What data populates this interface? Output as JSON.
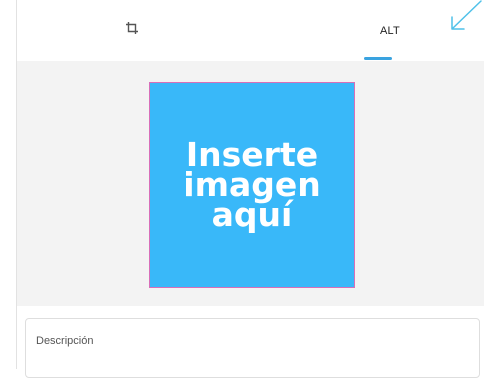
{
  "tabs": {
    "crop_icon": "crop-icon",
    "alt_label": "ALT",
    "active": "alt"
  },
  "image_placeholder": {
    "text": "Inserte\nimagen\naquí",
    "fill_color": "#39b8f9"
  },
  "description_field": {
    "label": "Descripción"
  },
  "accent_color": "#3aa3e0",
  "annotation_arrow_color": "#4fc1e9"
}
